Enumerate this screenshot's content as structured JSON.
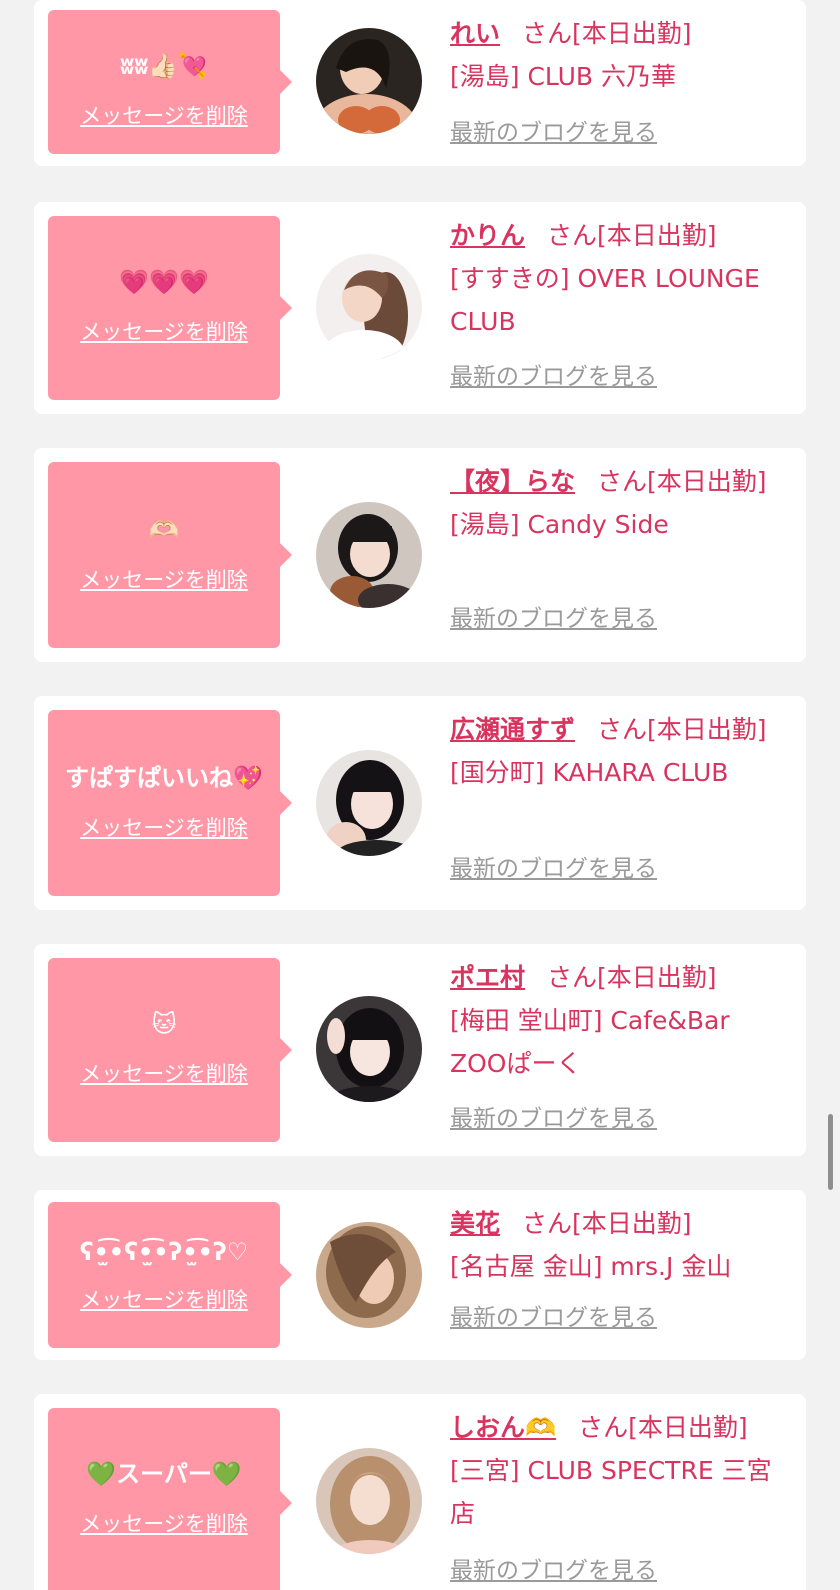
{
  "delete_label": "メッセージを削除",
  "blog_label": "最新のブログを見る",
  "san_label": "さん",
  "colors": {
    "bubble": "#ff97a6",
    "accent": "#d8345f",
    "link_gray": "#9a9a9a",
    "card": "#ffffff",
    "background": "#f2f2f2"
  },
  "items": [
    {
      "message": "ʬʬ👍🏻💘",
      "name": "れい",
      "status": "[本日出勤]",
      "location": "[湯島] CLUB 六乃華",
      "avatar": "photo-avatar"
    },
    {
      "message": "💗💗💗",
      "name": "かりん",
      "status": "[本日出勤]",
      "location": "[すすきの] OVER LOUNGE CLUB",
      "avatar": "photo-avatar"
    },
    {
      "message": "🫶🏻",
      "name": "【夜】らな",
      "status": "[本日出勤]",
      "location": "[湯島] Candy Side",
      "avatar": "photo-avatar"
    },
    {
      "message": "すぱすぱいいね💖",
      "name": "広瀬通すず",
      "status": "[本日出勤]",
      "location": "[国分町] KAHARA CLUB",
      "avatar": "photo-avatar"
    },
    {
      "message": "🐱",
      "name": "ポエ村",
      "status": "[本日出勤]",
      "location": "[梅田 堂山町] Cafe&Bar ZOOぱーく",
      "avatar": "photo-avatar"
    },
    {
      "message": "ʕ•̫͡•ʕ•̫͡•ʔ•̫͡•ʔ♡",
      "name": "美花",
      "status": "[本日出勤]",
      "location": "[名古屋 金山] mrs.J 金山",
      "avatar": "photo-avatar"
    },
    {
      "message": "💚スーパー💚",
      "name": "しおん🫶",
      "status": "[本日出勤]",
      "location": "[三宮] CLUB SPECTRE 三宮店",
      "avatar": "photo-avatar"
    }
  ]
}
